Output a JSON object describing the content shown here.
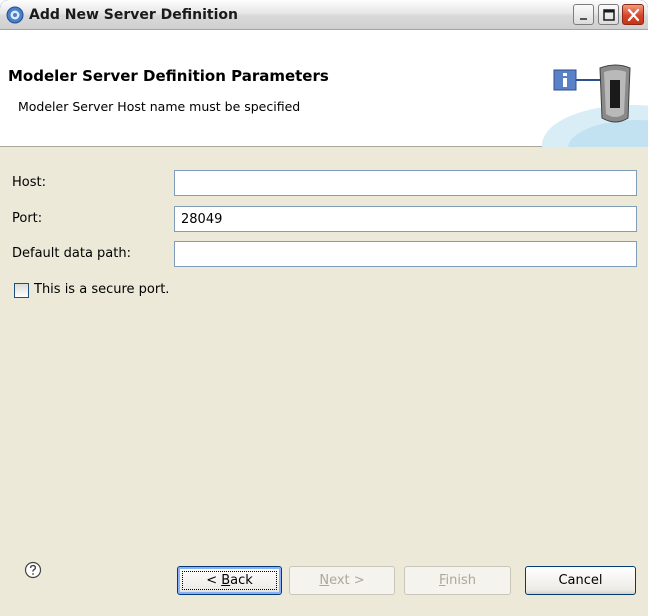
{
  "window": {
    "title": "Add New Server Definition"
  },
  "banner": {
    "title": "Modeler Server Definition Parameters",
    "message": "Modeler Server Host name must be specified"
  },
  "form": {
    "host": {
      "label": "Host:",
      "value": ""
    },
    "port": {
      "label": "Port:",
      "value": "28049"
    },
    "data_path": {
      "label": "Default data path:",
      "value": ""
    },
    "secure": {
      "label": "This is a secure port.",
      "checked": false
    }
  },
  "buttons": {
    "back": {
      "prefix": "< ",
      "mnemonic": "B",
      "rest": "ack"
    },
    "next": {
      "mnemonic": "N",
      "rest": "ext >"
    },
    "finish": {
      "mnemonic": "F",
      "rest": "inish"
    },
    "cancel": "Cancel"
  },
  "icons": {
    "app": "wizard-app-icon",
    "help": "help-icon",
    "banner": "server-info-icon"
  },
  "colors": {
    "dialog_bg": "#ece9d8",
    "banner_bg": "#ffffff",
    "input_border": "#7f9db9",
    "close_button": "#c23717"
  }
}
